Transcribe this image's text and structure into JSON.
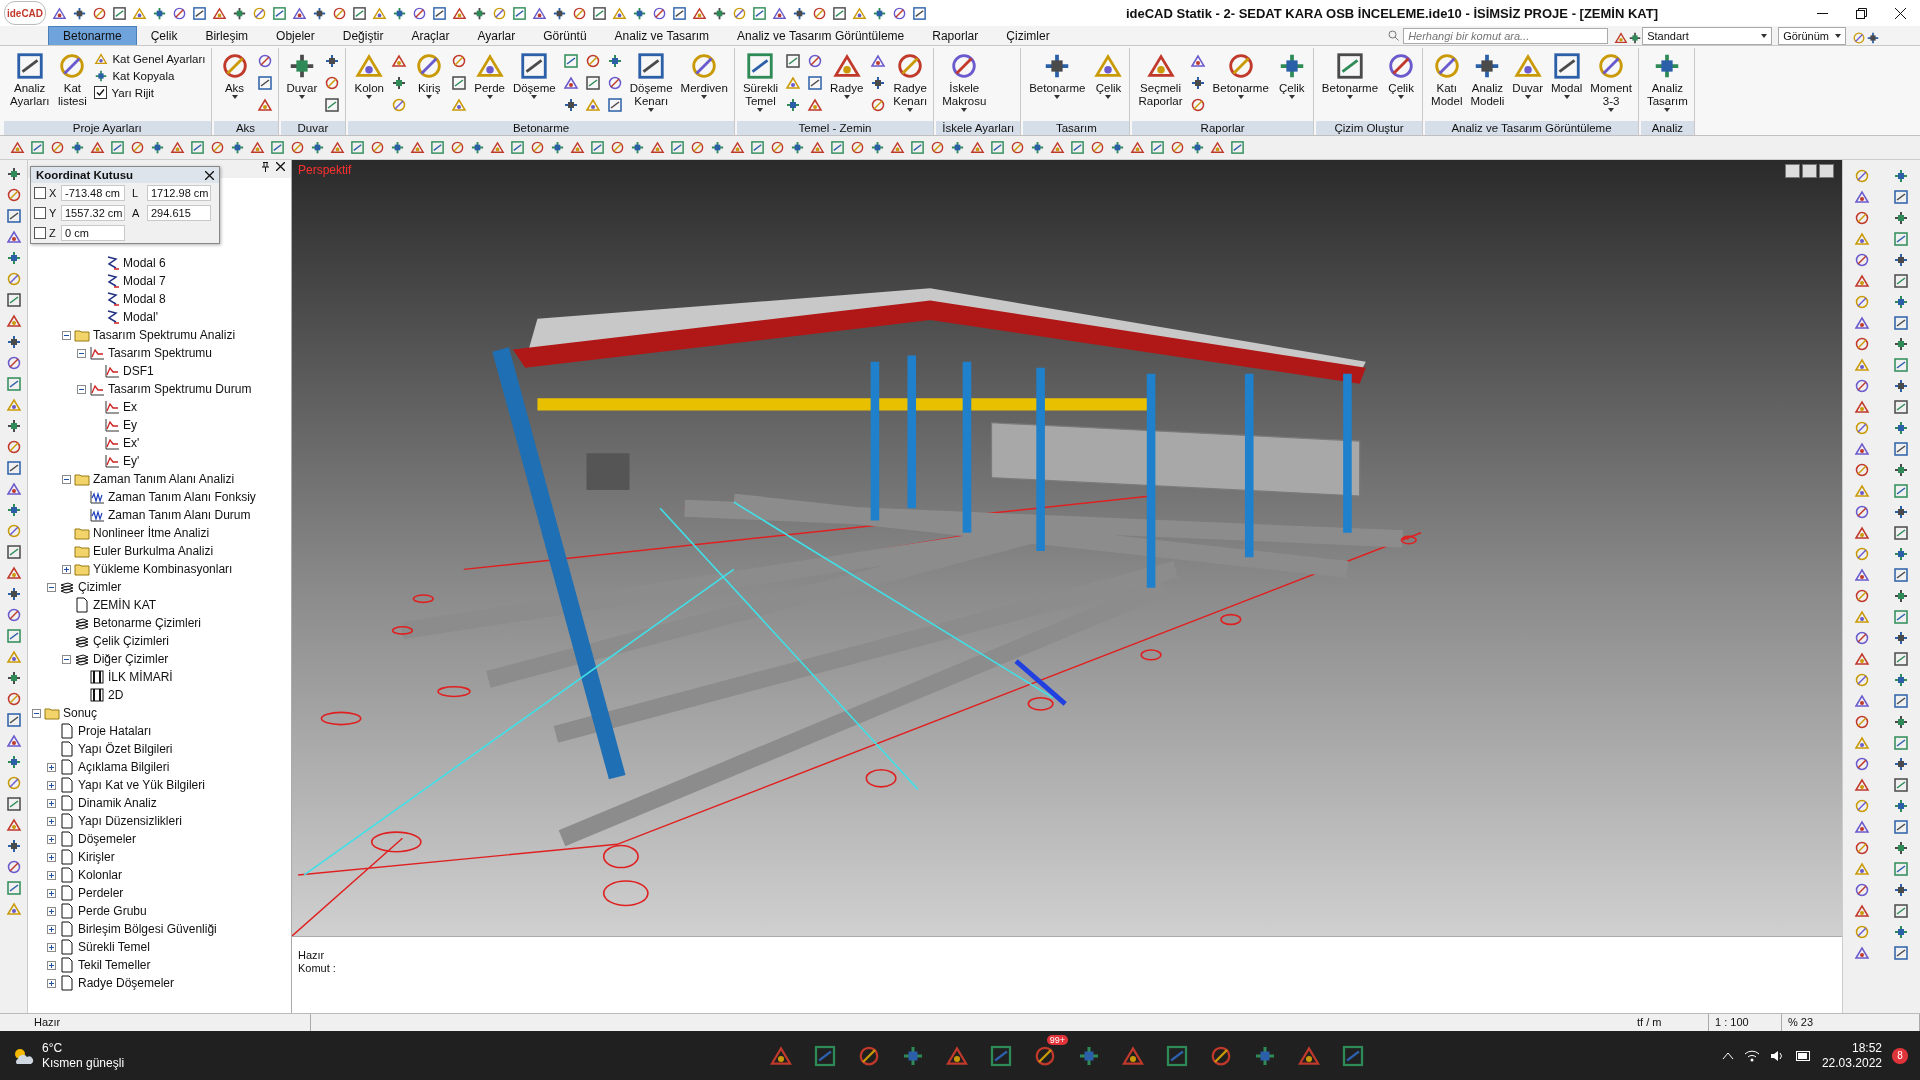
{
  "app_logo": "ideCAD",
  "window": {
    "title": "ideCAD Statik - 2- SEDAT KARA OSB İNCELEME.ide10 - İSİMSİZ PROJE - [ZEMİN KAT]"
  },
  "tabs": [
    {
      "label": "Betonarme",
      "selected": true
    },
    {
      "label": "Çelik",
      "selected": false
    },
    {
      "label": "Birleşim",
      "selected": false
    },
    {
      "label": "Objeler",
      "selected": false
    },
    {
      "label": "Değiştir",
      "selected": false
    },
    {
      "label": "Araçlar",
      "selected": false
    },
    {
      "label": "Ayarlar",
      "selected": false
    },
    {
      "label": "Görüntü",
      "selected": false
    },
    {
      "label": "Analiz ve Tasarım",
      "selected": false
    },
    {
      "label": "Analiz ve Tasarım Görüntüleme",
      "selected": false
    },
    {
      "label": "Raporlar",
      "selected": false
    },
    {
      "label": "Çizimler",
      "selected": false
    }
  ],
  "command_search": {
    "placeholder": "Herhangi bir komut ara..."
  },
  "style_dropdown": "Standart",
  "view_menu": "Görünüm",
  "ribbon": [
    {
      "label": "Proje Ayarları",
      "items": [
        {
          "kind": "large",
          "lines": [
            "Analiz",
            "Ayarları"
          ],
          "dropdown": false
        },
        {
          "kind": "large",
          "lines": [
            "Kat",
            "listesi"
          ],
          "dropdown": false
        },
        {
          "kind": "small_column",
          "items": [
            {
              "kind": "button",
              "label": "Kat Genel Ayarları"
            },
            {
              "kind": "button",
              "label": "Kat Kopyala"
            },
            {
              "kind": "check",
              "label": "Yarı Rijit",
              "checked": true
            }
          ]
        }
      ]
    },
    {
      "label": "Aks",
      "items": [
        {
          "kind": "large",
          "lines": [
            "Aks"
          ],
          "dropdown": true
        },
        {
          "kind": "icon_column"
        }
      ]
    },
    {
      "label": "Duvar",
      "items": [
        {
          "kind": "large",
          "lines": [
            "Duvar"
          ],
          "dropdown": true
        },
        {
          "kind": "icon_column"
        }
      ]
    },
    {
      "label": "Betonarme",
      "items": [
        {
          "kind": "large",
          "lines": [
            "Kolon"
          ],
          "dropdown": true
        },
        {
          "kind": "icon_column"
        },
        {
          "kind": "large",
          "lines": [
            "Kiriş"
          ],
          "dropdown": true
        },
        {
          "kind": "icon_column"
        },
        {
          "kind": "large",
          "lines": [
            "Perde"
          ],
          "dropdown": true
        },
        {
          "kind": "large",
          "lines": [
            "Döşeme"
          ],
          "dropdown": true
        },
        {
          "kind": "icon_column"
        },
        {
          "kind": "icon_column"
        },
        {
          "kind": "icon_column"
        },
        {
          "kind": "large",
          "lines": [
            "Döşeme",
            "Kenarı"
          ],
          "dropdown": true
        },
        {
          "kind": "large",
          "lines": [
            "Merdiven"
          ],
          "dropdown": true
        }
      ]
    },
    {
      "label": "Temel - Zemin",
      "items": [
        {
          "kind": "large",
          "lines": [
            "Sürekli",
            "Temel"
          ],
          "dropdown": true
        },
        {
          "kind": "icon_column"
        },
        {
          "kind": "icon_column"
        },
        {
          "kind": "large",
          "lines": [
            "Radye"
          ],
          "dropdown": true
        },
        {
          "kind": "icon_column"
        },
        {
          "kind": "large",
          "lines": [
            "Radye",
            "Kenarı"
          ],
          "dropdown": true
        }
      ]
    },
    {
      "label": "İskele Ayarları",
      "items": [
        {
          "kind": "large",
          "lines": [
            "İskele",
            "Makrosu"
          ],
          "dropdown": true
        }
      ]
    },
    {
      "label": "Tasarım",
      "items": [
        {
          "kind": "large",
          "lines": [
            "Betonarme"
          ],
          "dropdown": true
        },
        {
          "kind": "large",
          "lines": [
            "Çelik"
          ],
          "dropdown": true
        }
      ]
    },
    {
      "label": "Raporlar",
      "items": [
        {
          "kind": "large",
          "lines": [
            "Seçmeli",
            "Raporlar"
          ],
          "dropdown": false
        },
        {
          "kind": "icon_column"
        },
        {
          "kind": "large",
          "lines": [
            "Betonarme"
          ],
          "dropdown": true
        },
        {
          "kind": "large",
          "lines": [
            "Çelik"
          ],
          "dropdown": true
        }
      ]
    },
    {
      "label": "Çizim Oluştur",
      "items": [
        {
          "kind": "large",
          "lines": [
            "Betonarme"
          ],
          "dropdown": true
        },
        {
          "kind": "large",
          "lines": [
            "Çelik"
          ],
          "dropdown": true
        }
      ]
    },
    {
      "label": "Analiz ve Tasarım Görüntüleme",
      "items": [
        {
          "kind": "large",
          "lines": [
            "Katı",
            "Model"
          ],
          "dropdown": false
        },
        {
          "kind": "large",
          "lines": [
            "Analiz",
            "Modeli"
          ],
          "dropdown": false
        },
        {
          "kind": "large",
          "lines": [
            "Duvar"
          ],
          "dropdown": true
        },
        {
          "kind": "large",
          "lines": [
            "Modal"
          ],
          "dropdown": true
        },
        {
          "kind": "large",
          "lines": [
            "Moment",
            "3-3"
          ],
          "dropdown": true
        }
      ]
    },
    {
      "label": "Analiz",
      "items": [
        {
          "kind": "large",
          "lines": [
            "Analiz",
            "Tasarım"
          ],
          "dropdown": true
        }
      ]
    }
  ],
  "coordinate_box": {
    "title": "Koordinat Kutusu",
    "fields": [
      {
        "axis": "X",
        "checked": false,
        "value": "-713.48 cm",
        "extra_label": "L",
        "extra_value": "1712.98 cm"
      },
      {
        "axis": "Y",
        "checked": false,
        "value": "1557.32 cm",
        "extra_label": "A",
        "extra_value": "294.615"
      },
      {
        "axis": "Z",
        "checked": false,
        "value": "0 cm"
      }
    ]
  },
  "tree": [
    {
      "children": [
        {
          "children": [
            {
              "children": [
                {
                  "children": [
                    {
                      "label": "Modal 6",
                      "kind": "mode"
                    },
                    {
                      "label": "Modal 7",
                      "kind": "mode"
                    },
                    {
                      "label": "Modal 8",
                      "kind": "mode"
                    },
                    {
                      "label": "Modal'",
                      "kind": "mode"
                    }
                  ]
                }
              ]
            },
            {
              "label": "Tasarım Spektrumu Analizi",
              "kind": "folder",
              "expanded": true,
              "children": [
                {
                  "label": "Tasarım Spektrumu",
                  "kind": "chart",
                  "expanded": true,
                  "children": [
                    {
                      "label": "DSF1",
                      "kind": "chart"
                    }
                  ]
                },
                {
                  "label": "Tasarım Spektrumu Durum",
                  "kind": "chart",
                  "expanded": true,
                  "children": [
                    {
                      "label": "Ex",
                      "kind": "chart"
                    },
                    {
                      "label": "Ey",
                      "kind": "chart"
                    },
                    {
                      "label": "Ex'",
                      "kind": "chart"
                    },
                    {
                      "label": "Ey'",
                      "kind": "chart"
                    }
                  ]
                }
              ]
            },
            {
              "label": "Zaman Tanım Alanı Analizi",
              "kind": "folder",
              "expanded": true,
              "children": [
                {
                  "label": "Zaman Tanım Alanı Fonksiy",
                  "kind": "wave"
                },
                {
                  "label": "Zaman Tanım Alanı Durum",
                  "kind": "wave"
                }
              ]
            },
            {
              "label": "Nonlineer İtme Analizi",
              "kind": "folder"
            },
            {
              "label": "Euler Burkulma Analizi",
              "kind": "folder"
            },
            {
              "label": "Yükleme Kombinasyonları",
              "kind": "folder",
              "expanded": false
            }
          ]
        },
        {
          "label": "Çizimler",
          "kind": "layers",
          "expanded": true,
          "children": [
            {
              "label": "ZEMİN KAT",
              "kind": "page"
            },
            {
              "label": "Betonarme Çizimleri",
              "kind": "layers"
            },
            {
              "label": "Çelik Çizimleri",
              "kind": "layers"
            },
            {
              "label": "Diğer Çizimler",
              "kind": "layers",
              "expanded": true,
              "children": [
                {
                  "label": "İLK MİMARİ",
                  "kind": "sheet"
                },
                {
                  "label": "2D",
                  "kind": "sheet"
                }
              ]
            }
          ]
        }
      ]
    },
    {
      "label": "Sonuç",
      "kind": "folder",
      "expanded": true,
      "children": [
        {
          "label": "Proje Hataları",
          "kind": "page"
        },
        {
          "label": "Yapı Özet Bilgileri",
          "kind": "page"
        },
        {
          "label": "Açıklama Bilgileri",
          "kind": "page",
          "expanded": false
        },
        {
          "label": "Yapı Kat ve Yük Bilgileri",
          "kind": "page",
          "expanded": false
        },
        {
          "label": "Dinamik Analiz",
          "kind": "page",
          "expanded": false
        },
        {
          "label": "Yapı Düzensizlikleri",
          "kind": "page",
          "expanded": false
        },
        {
          "label": "Döşemeler",
          "kind": "page",
          "expanded": false
        },
        {
          "label": "Kirişler",
          "kind": "page",
          "expanded": false
        },
        {
          "label": "Kolonlar",
          "kind": "page",
          "expanded": false
        },
        {
          "label": "Perdeler",
          "kind": "page",
          "expanded": false
        },
        {
          "label": "Perde Grubu",
          "kind": "page",
          "expanded": false
        },
        {
          "label": "Birleşim Bölgesi Güvenliği",
          "kind": "page",
          "expanded": false
        },
        {
          "label": "Sürekli Temel",
          "kind": "page",
          "expanded": false
        },
        {
          "label": "Tekil Temeller",
          "kind": "page",
          "expanded": false
        },
        {
          "label": "Radye Döşemeler",
          "kind": "page",
          "expanded": false
        }
      ]
    }
  ],
  "viewport": {
    "label": "Perspektif"
  },
  "command_area": {
    "message": "Hazır",
    "prompt": "Komut :"
  },
  "status_bar": {
    "message": "Hazır",
    "unit": "tf / m",
    "scale": "1 : 100",
    "zoom": "% 23"
  },
  "taskbar": {
    "temperature": "6°C",
    "weather": "Kısmen güneşli",
    "mail_badge": "99+",
    "time": "18:52",
    "date": "22.03.2022",
    "notifications": "8"
  }
}
